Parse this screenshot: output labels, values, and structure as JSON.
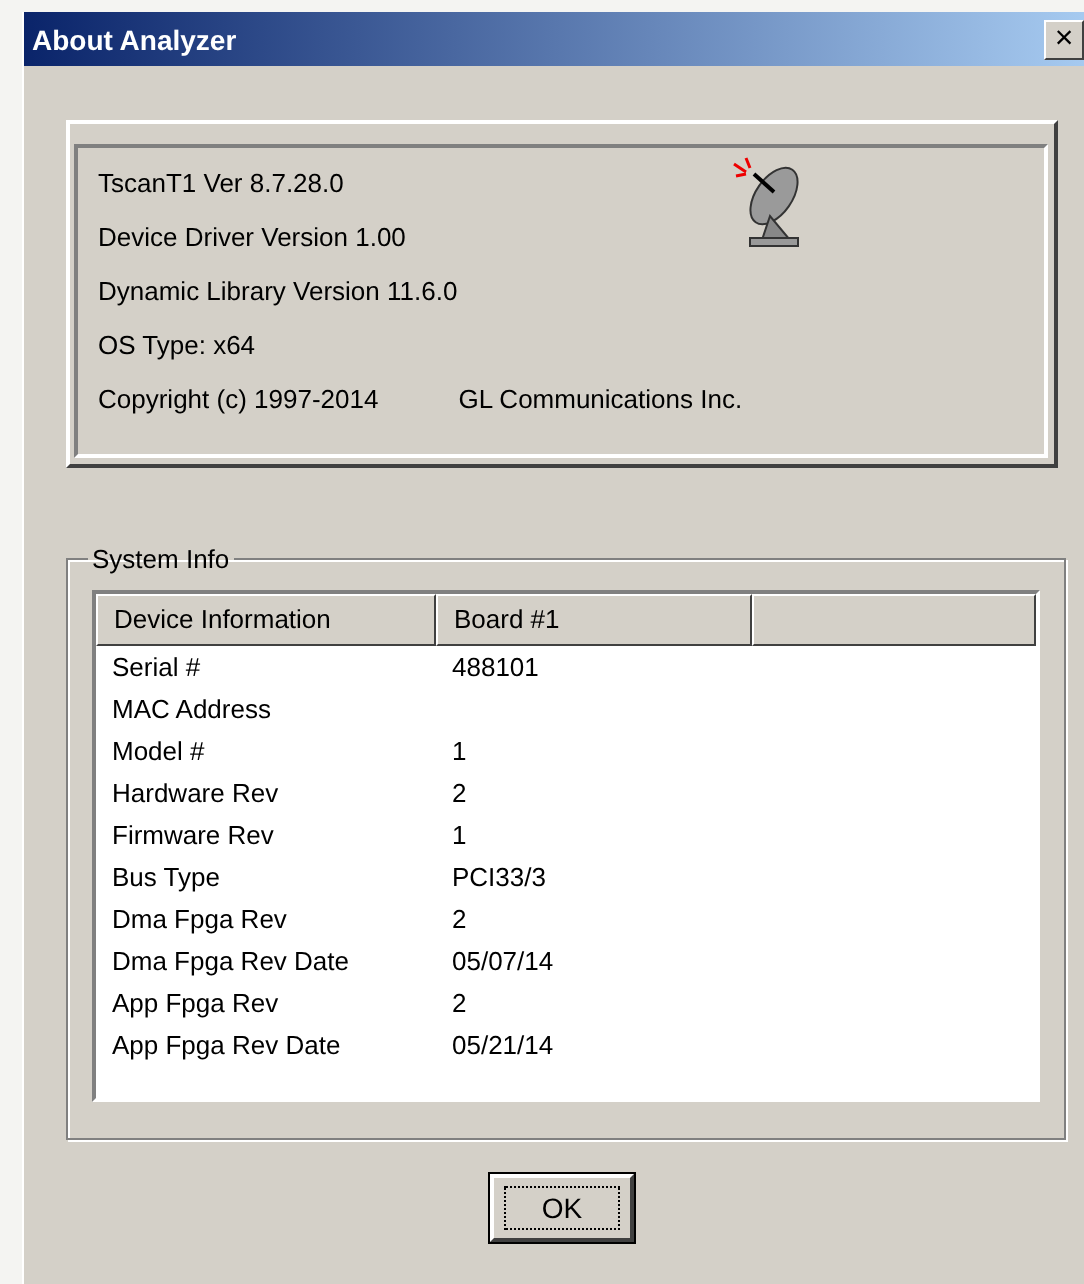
{
  "window": {
    "title": "About Analyzer",
    "close": "×"
  },
  "info": {
    "lines": [
      "TscanT1 Ver 8.7.28.0",
      "Device Driver Version 1.00",
      "Dynamic Library Version 11.6.0",
      "OS Type: x64"
    ],
    "copyright": "Copyright  (c) 1997-2014",
    "company": "GL Communications Inc."
  },
  "system_info": {
    "legend": "System Info",
    "columns": [
      "Device Information",
      "Board #1"
    ],
    "rows": [
      {
        "label": "Serial #",
        "value": "488101"
      },
      {
        "label": "MAC Address"
      },
      {
        "label": "Model #",
        "value": "1"
      },
      {
        "label": "Hardware Rev",
        "value": "2"
      },
      {
        "label": "Firmware Rev",
        "value": "1"
      },
      {
        "label": "Bus Type",
        "value": "PCI33/3"
      },
      {
        "label": "Dma Fpga Rev",
        "value": "2"
      },
      {
        "label": "Dma Fpga Rev Date",
        "value": "05/07/14"
      },
      {
        "label": "App Fpga Rev",
        "value": "2"
      },
      {
        "label": "App Fpga Rev Date",
        "value": "05/21/14"
      }
    ]
  },
  "buttons": [
    "OK"
  ]
}
